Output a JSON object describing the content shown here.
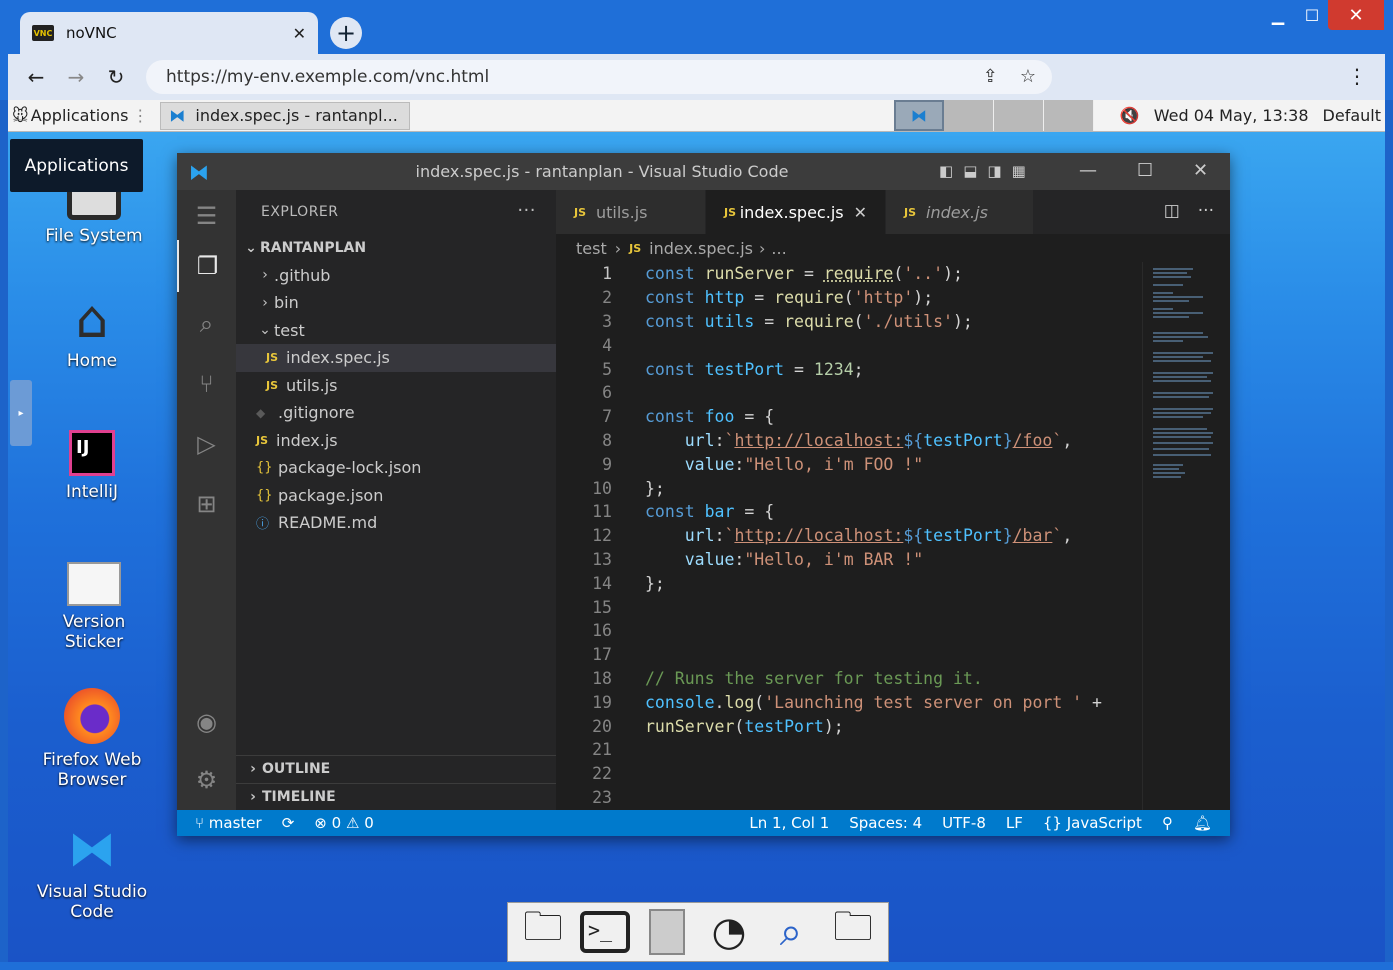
{
  "browser": {
    "tab_title": "noVNC",
    "tab_icon_text": "VNC",
    "url": "https://my-env.exemple.com/vnc.html"
  },
  "panel": {
    "applications": "Applications",
    "task_title": "index.spec.js - rantanpl...",
    "clock": "Wed 04 May, 13:38",
    "user": "Default"
  },
  "desktop": {
    "tooltip": "Applications",
    "icons": [
      "File System",
      "Home",
      "IntelliJ",
      "Version Sticker",
      "Firefox Web Browser",
      "Visual Studio Code"
    ],
    "intellij_logo": "IJ"
  },
  "vscode": {
    "title": "index.spec.js - rantanplan - Visual Studio Code",
    "explorer_title": "EXPLORER",
    "root": "RANTANPLAN",
    "tree": [
      {
        "label": ".github"
      },
      {
        "label": "bin"
      },
      {
        "label": "test"
      },
      {
        "label": "index.spec.js"
      },
      {
        "label": "utils.js"
      },
      {
        "label": ".gitignore"
      },
      {
        "label": "index.js"
      },
      {
        "label": "package-lock.json"
      },
      {
        "label": "package.json"
      },
      {
        "label": "README.md"
      }
    ],
    "outline": "OUTLINE",
    "timeline": "TIMELINE",
    "tabs": [
      {
        "label": "utils.js"
      },
      {
        "label": "index.spec.js"
      },
      {
        "label": "index.js"
      }
    ],
    "breadcrumb": {
      "folder": "test",
      "file": "index.spec.js",
      "more": "..."
    },
    "status": {
      "branch": "master",
      "errors": "0",
      "warnings": "0",
      "position": "Ln 1, Col 1",
      "spaces": "Spaces: 4",
      "encoding": "UTF-8",
      "eol": "LF",
      "language": "JavaScript"
    },
    "line_numbers": [
      "1",
      "2",
      "3",
      "4",
      "5",
      "6",
      "7",
      "8",
      "9",
      "10",
      "11",
      "12",
      "13",
      "14",
      "15",
      "16",
      "17",
      "18",
      "19",
      "20",
      "21",
      "22",
      "23"
    ],
    "code": {
      "l1": [
        "const",
        "runServer",
        " = ",
        "require",
        "(",
        "'..'",
        ");"
      ],
      "l2": [
        "const",
        "http",
        " = ",
        "require",
        "(",
        "'http'",
        ");"
      ],
      "l3": [
        "const",
        "utils",
        " = ",
        "require",
        "(",
        "'./utils'",
        ");"
      ],
      "l5": [
        "const",
        "testPort",
        " = ",
        "1234",
        ";"
      ],
      "l7": [
        "const",
        "foo",
        " = {"
      ],
      "l8": [
        "url",
        ":",
        "`",
        "http://localhost:",
        "${",
        "testPort",
        "}",
        "/foo",
        "`",
        ","
      ],
      "l9": [
        "value",
        ":",
        "\"Hello, i'm FOO !\""
      ],
      "l10": [
        "};"
      ],
      "l11": [
        "const",
        "bar",
        " = {"
      ],
      "l12": [
        "url",
        ":",
        "`",
        "http://localhost:",
        "${",
        "testPort",
        "}",
        "/bar",
        "`",
        ","
      ],
      "l13": [
        "value",
        ":",
        "\"Hello, i'm BAR !\""
      ],
      "l14": [
        "};"
      ],
      "l18": [
        "// Runs the server for testing it."
      ],
      "l19": [
        "console",
        ".",
        "log",
        "(",
        "'Launching test server on port '",
        " + "
      ],
      "l20": [
        "runServer",
        "(",
        "testPort",
        ");"
      ]
    }
  }
}
